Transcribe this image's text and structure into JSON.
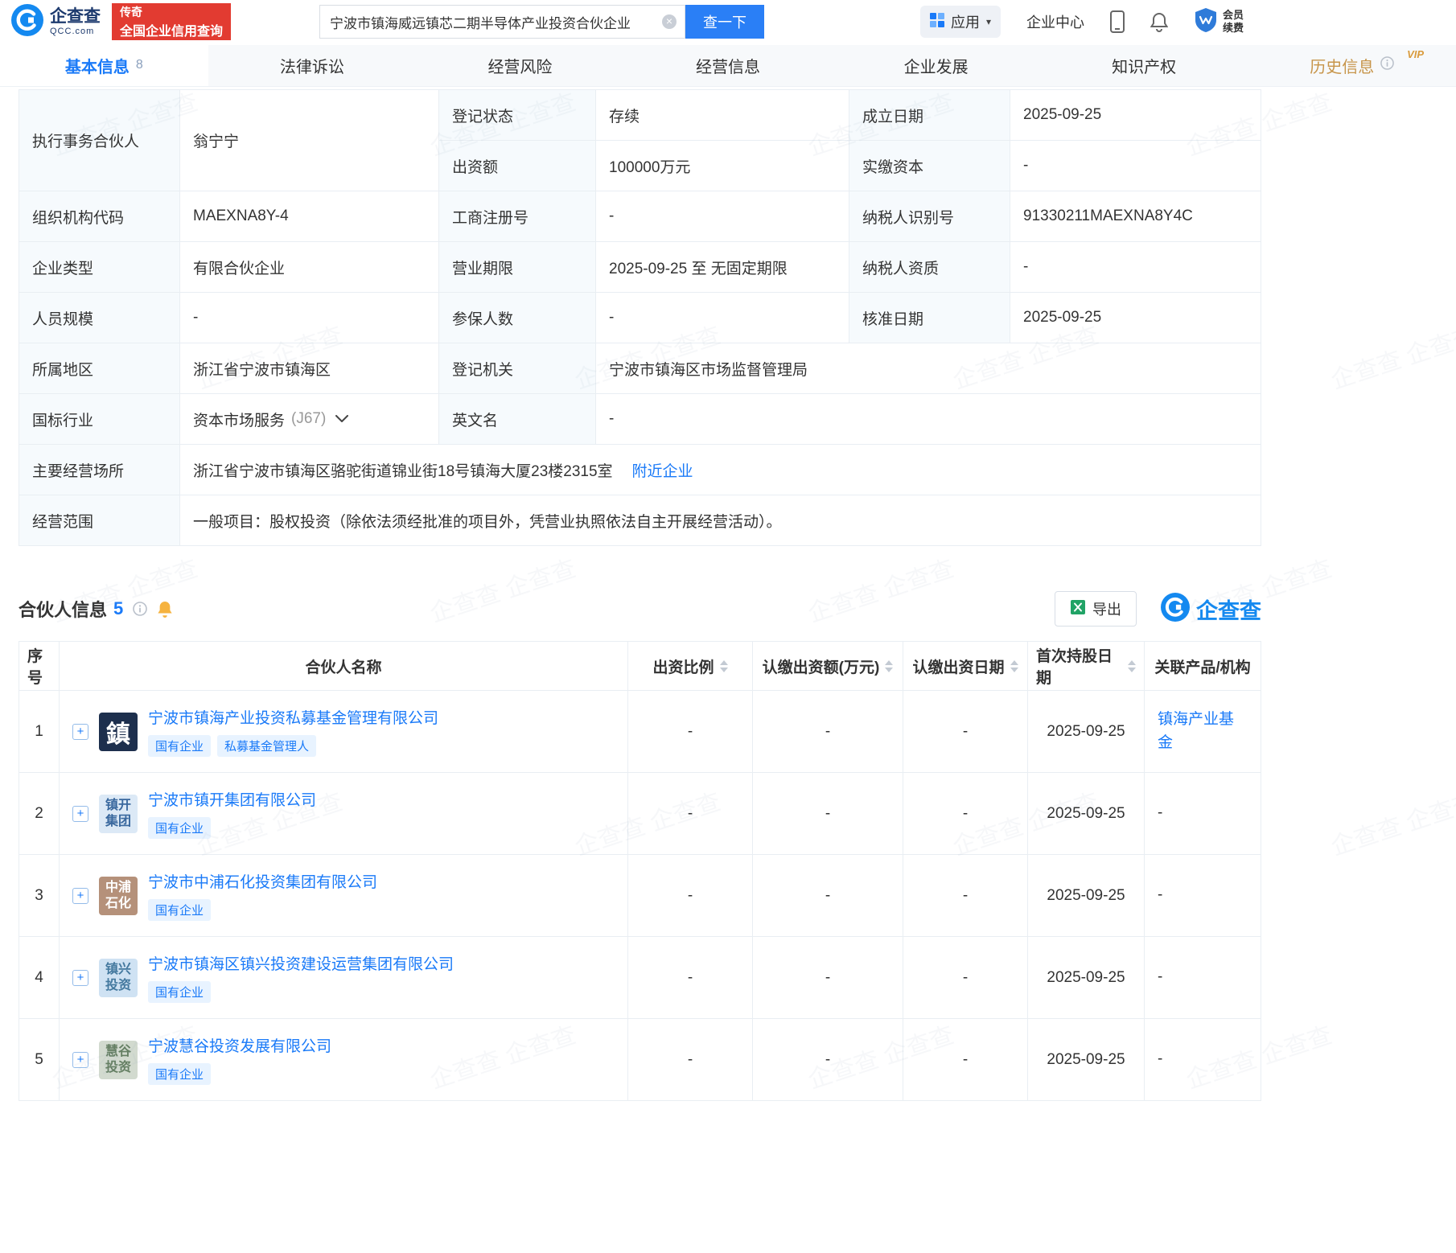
{
  "colors": {
    "accent_blue": "#1a7af8",
    "brand_blue": "#1489f0",
    "promo_red": "#e23b31",
    "history_gold": "#c7954a",
    "tag_bg": "#e8f3ff",
    "label_cell_bg": "#f6fafd",
    "border": "#e9eef3",
    "excel_green": "#21a366"
  },
  "icons": {
    "clear": "×",
    "caret": "▾",
    "plus": "+"
  },
  "watermark": "企查查",
  "header": {
    "logo": {
      "text": "企查查",
      "sub": "QCC.com"
    },
    "promo": {
      "line1": "传奇",
      "line2": "全国企业信用查询"
    },
    "search": {
      "value": "宁波市镇海威远镇芯二期半导体产业投资合伙企业",
      "button": "查一下"
    },
    "apps": "应用",
    "enterprise_center": "企业中心",
    "member": {
      "line1": "会员",
      "line2": "续费"
    }
  },
  "tabs": [
    {
      "label": "基本信息",
      "count": "8"
    },
    {
      "label": "法律诉讼"
    },
    {
      "label": "经营风险"
    },
    {
      "label": "经营信息"
    },
    {
      "label": "企业发展"
    },
    {
      "label": "知识产权"
    },
    {
      "label": "历史信息",
      "vip": "VIP"
    }
  ],
  "basic_info": {
    "executive_partner_label": "执行事务合伙人",
    "executive_partner": "翁宁宁",
    "reg_status_label": "登记状态",
    "reg_status": "存续",
    "establish_date_label": "成立日期",
    "establish_date": "2025-09-25",
    "capital_label": "出资额",
    "capital": "100000万元",
    "paid_capital_label": "实缴资本",
    "paid_capital": "-",
    "org_code_label": "组织机构代码",
    "org_code": "MAEXNA8Y-4",
    "biz_reg_no_label": "工商注册号",
    "biz_reg_no": "-",
    "taxpayer_id_label": "纳税人识别号",
    "taxpayer_id": "91330211MAEXNA8Y4C",
    "company_type_label": "企业类型",
    "company_type": "有限合伙企业",
    "biz_term_label": "营业期限",
    "biz_term": "2025-09-25 至 无固定期限",
    "taxpayer_qual_label": "纳税人资质",
    "taxpayer_qual": "-",
    "staff_size_label": "人员规模",
    "staff_size": "-",
    "insured_label": "参保人数",
    "insured": "-",
    "approval_date_label": "核准日期",
    "approval_date": "2025-09-25",
    "region_label": "所属地区",
    "region": "浙江省宁波市镇海区",
    "reg_authority_label": "登记机关",
    "reg_authority": "宁波市镇海区市场监督管理局",
    "industry_label": "国标行业",
    "industry": "资本市场服务",
    "industry_code": "(J67)",
    "english_name_label": "英文名",
    "english_name": "-",
    "address_label": "主要经营场所",
    "address": "浙江省宁波市镇海区骆驼街道锦业街18号镇海大厦23楼2315室",
    "nearby_link": "附近企业",
    "business_scope_label": "经营范围",
    "business_scope": "一般项目：股权投资（除依法须经批准的项目外，凭营业执照依法自主开展经营活动）。"
  },
  "partners": {
    "title": "合伙人信息",
    "count": "5",
    "export_label": "导出",
    "brand": "企查查",
    "columns": [
      "序号",
      "合伙人名称",
      "出资比例",
      "认缴出资额(万元)",
      "认缴出资日期",
      "首次持股日期",
      "关联产品/机构"
    ],
    "rows": [
      {
        "no": "1",
        "name": "宁波市镇海产业投资私募基金管理有限公司",
        "tags": [
          "国有企业",
          "私募基金管理人"
        ],
        "logo": {
          "text": "鎮"
        },
        "ratio": "-",
        "amount": "-",
        "date": "-",
        "first_date": "2025-09-25",
        "related": "镇海产业基金"
      },
      {
        "no": "2",
        "name": "宁波市镇开集团有限公司",
        "tags": [
          "国有企业"
        ],
        "logo": {
          "line1": "镇开",
          "line2": "集团"
        },
        "ratio": "-",
        "amount": "-",
        "date": "-",
        "first_date": "2025-09-25",
        "related": "-"
      },
      {
        "no": "3",
        "name": "宁波市中浦石化投资集团有限公司",
        "tags": [
          "国有企业"
        ],
        "logo": {
          "line1": "中浦",
          "line2": "石化"
        },
        "ratio": "-",
        "amount": "-",
        "date": "-",
        "first_date": "2025-09-25",
        "related": "-"
      },
      {
        "no": "4",
        "name": "宁波市镇海区镇兴投资建设运营集团有限公司",
        "tags": [
          "国有企业"
        ],
        "logo": {
          "line1": "镇兴",
          "line2": "投资"
        },
        "ratio": "-",
        "amount": "-",
        "date": "-",
        "first_date": "2025-09-25",
        "related": "-"
      },
      {
        "no": "5",
        "name": "宁波慧谷投资发展有限公司",
        "tags": [
          "国有企业"
        ],
        "logo": {
          "line1": "慧谷",
          "line2": "投资"
        },
        "ratio": "-",
        "amount": "-",
        "date": "-",
        "first_date": "2025-09-25",
        "related": "-"
      }
    ]
  }
}
